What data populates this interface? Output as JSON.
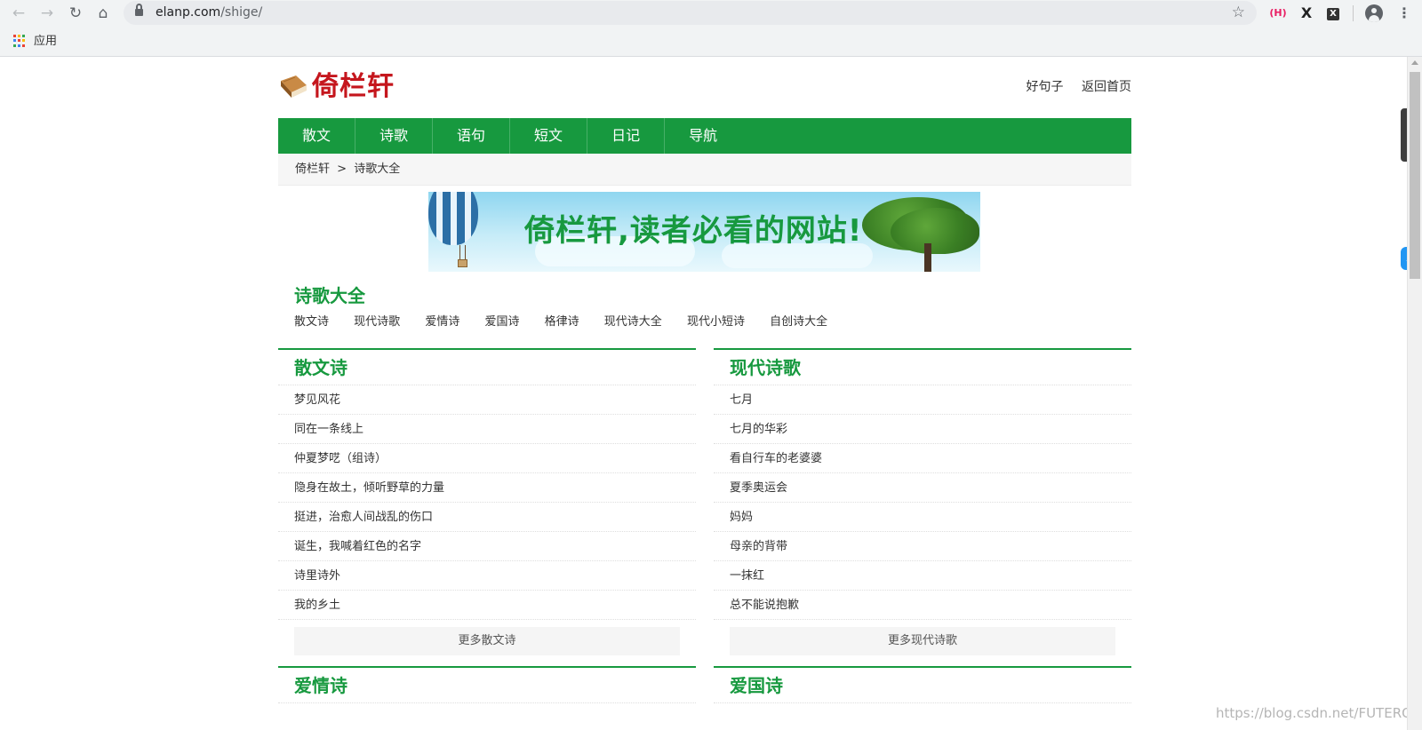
{
  "browser": {
    "url_host": "elanp.com",
    "url_path": "/shige/",
    "bookmark_apps_label": "应用",
    "ext_h": "(H)",
    "ext_x": "X",
    "ext_x2": "X"
  },
  "site": {
    "logo_text": "倚栏轩",
    "top_links": [
      "好句子",
      "返回首页"
    ],
    "nav": [
      "散文",
      "诗歌",
      "语句",
      "短文",
      "日记",
      "导航"
    ],
    "breadcrumb": {
      "home": "倚栏轩",
      "sep": ">",
      "current": "诗歌大全"
    },
    "banner_text": "倚栏轩,读者必看的网站!"
  },
  "section": {
    "title": "诗歌大全",
    "subnav": [
      "散文诗",
      "现代诗歌",
      "爱情诗",
      "爱国诗",
      "格律诗",
      "现代诗大全",
      "现代小短诗",
      "自创诗大全"
    ]
  },
  "columns": [
    {
      "title": "散文诗",
      "items": [
        "梦见风花",
        "同在一条线上",
        "仲夏梦呓（组诗）",
        "隐身在故土，倾听野草的力量",
        "挺进，治愈人间战乱的伤口",
        "诞生，我喊着红色的名字",
        "诗里诗外",
        "我的乡土"
      ],
      "more": "更多散文诗"
    },
    {
      "title": "现代诗歌",
      "items": [
        "七月",
        "七月的华彩",
        "看自行车的老婆婆",
        "夏季奥运会",
        "妈妈",
        "母亲的背带",
        "一抹红",
        "总不能说抱歉"
      ],
      "more": "更多现代诗歌"
    },
    {
      "title": "爱情诗"
    },
    {
      "title": "爱国诗"
    }
  ],
  "watermark": "https://blog.csdn.net/FUTEROX"
}
